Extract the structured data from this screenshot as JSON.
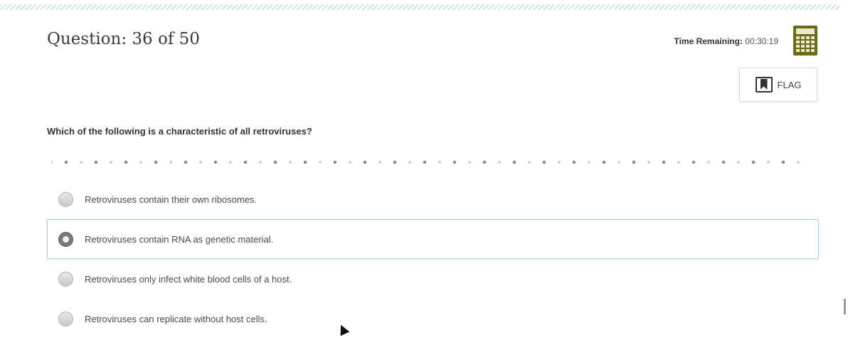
{
  "header": {
    "question_counter": "Question: 36 of 50",
    "time_label": "Time Remaining:",
    "time_value": "00:30:19",
    "calculator_icon": "calculator-icon",
    "flag_label": "FLAG",
    "flag_icon": "bookmark-flag-icon"
  },
  "question": {
    "text": "Which of the following is a characteristic of all retroviruses?"
  },
  "options": [
    {
      "label": "Retroviruses contain their own ribosomes.",
      "selected": false
    },
    {
      "label": "Retroviruses contain RNA as genetic material.",
      "selected": true
    },
    {
      "label": "Retroviruses only infect white blood cells of a host.",
      "selected": false
    },
    {
      "label": "Retroviruses can replicate without host cells.",
      "selected": false
    }
  ],
  "colors": {
    "calculator": "#6b6b15",
    "selected_border": "#a9cfe6",
    "divider_dot_dark": "#8a8a8a",
    "divider_dot_light": "#b8dbe8"
  }
}
